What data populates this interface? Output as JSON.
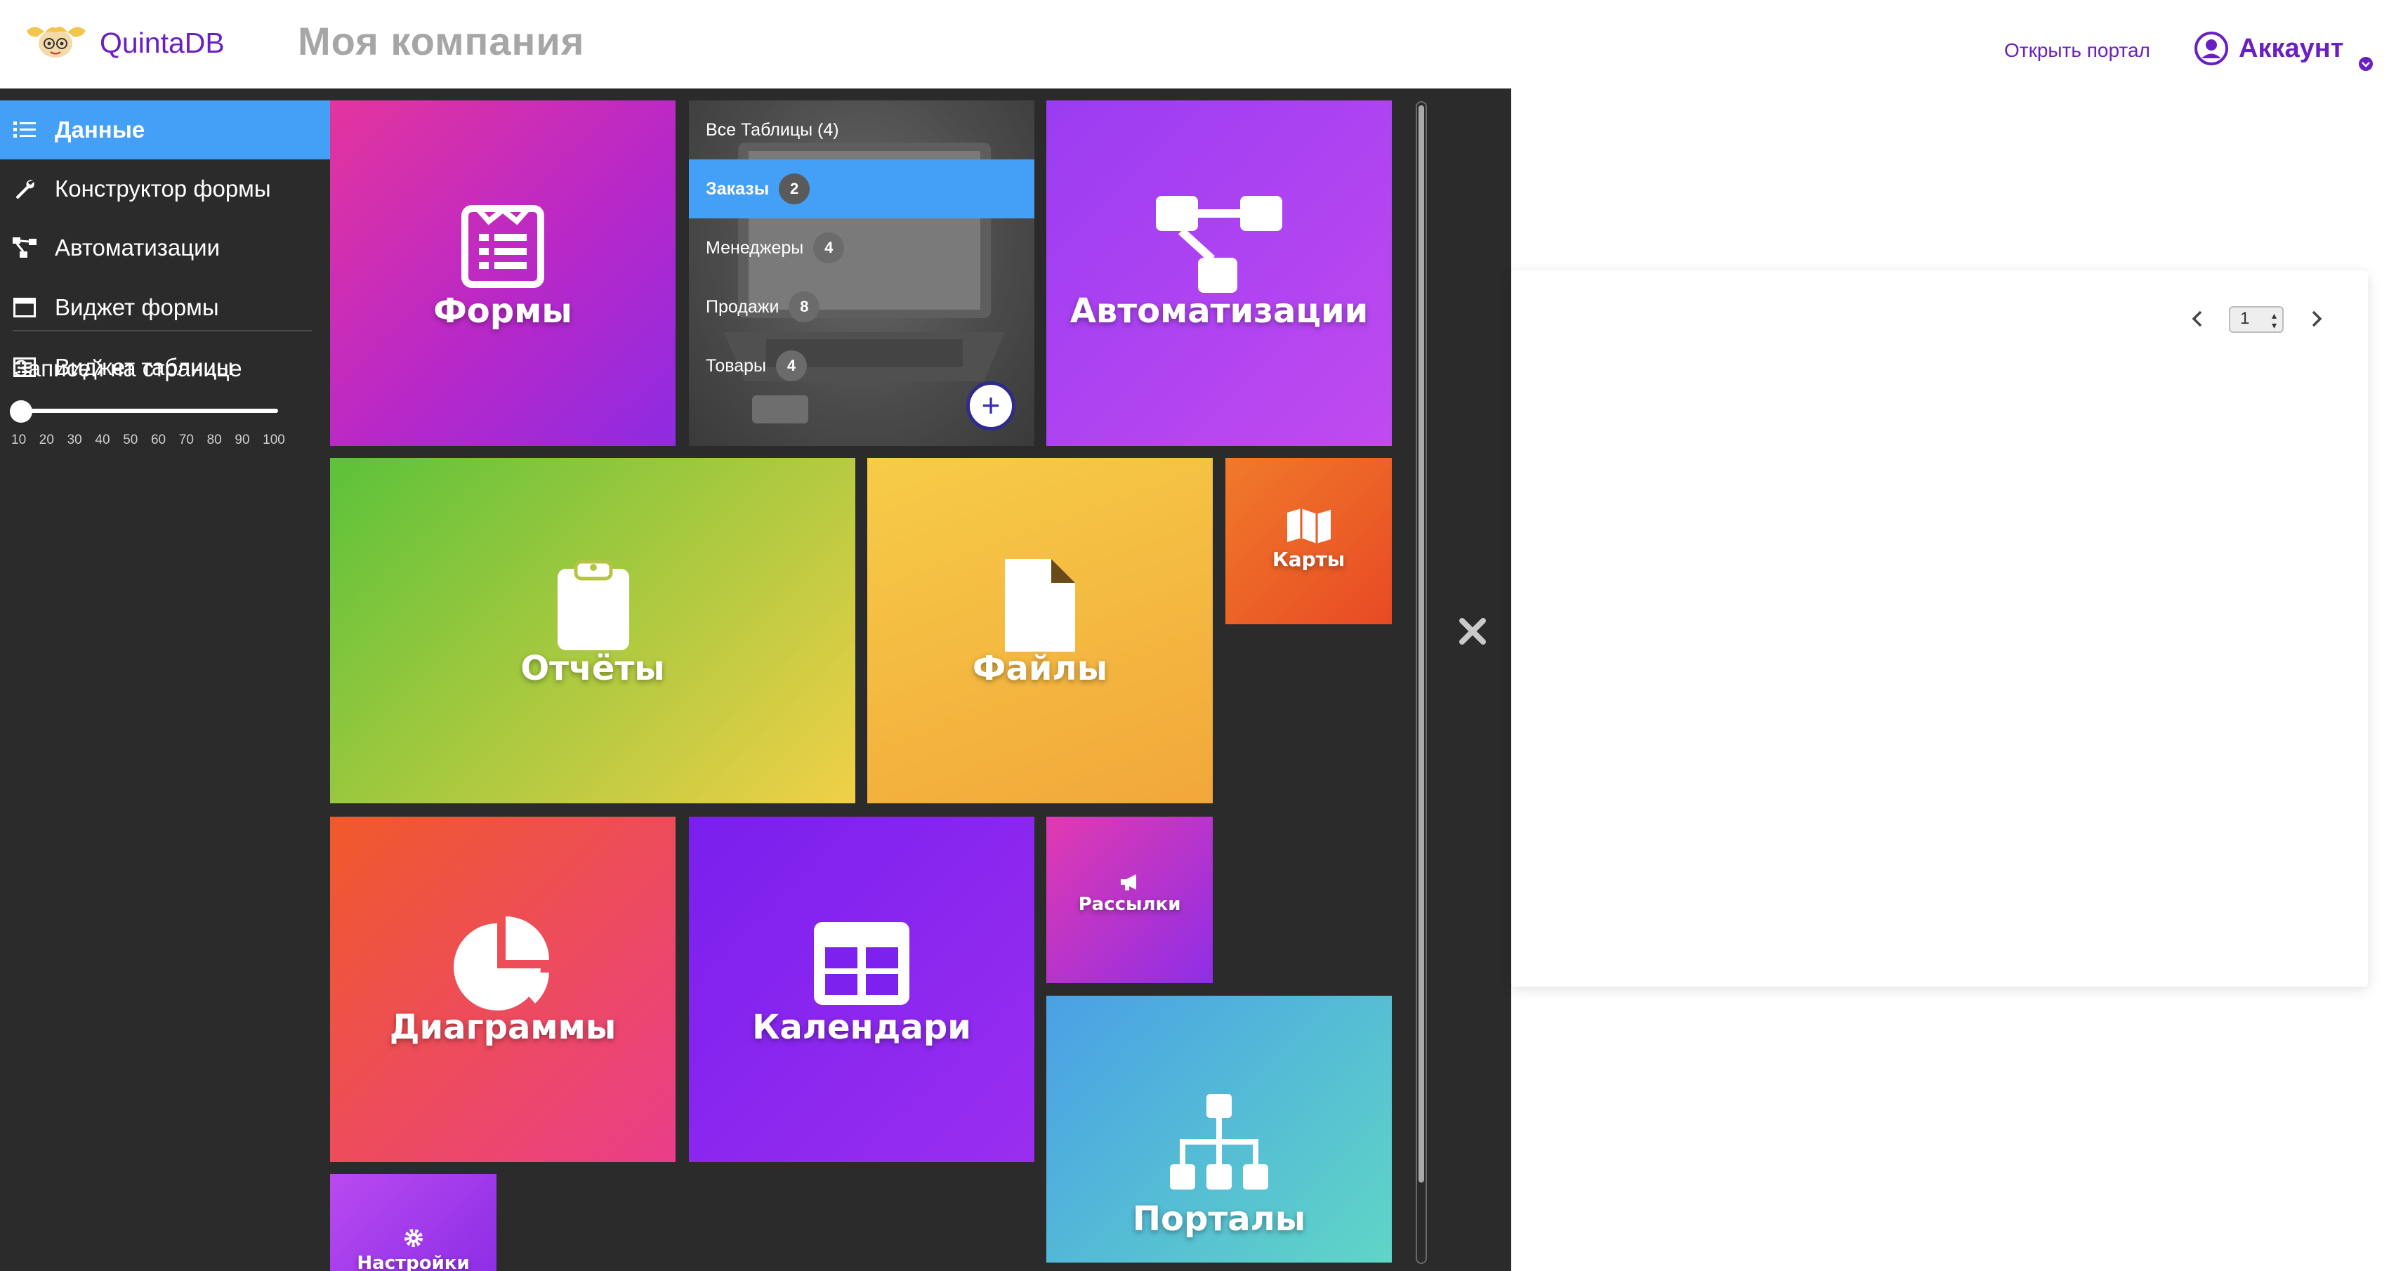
{
  "header": {
    "logo_text": "QuintaDB",
    "company_name": "Моя компания",
    "open_portal": "Открыть портал",
    "account": "Аккаунт"
  },
  "sidebar": {
    "items": [
      {
        "label": "Данные",
        "icon": "list-icon",
        "active": true
      },
      {
        "label": "Конструктор формы",
        "icon": "wrench-icon",
        "active": false
      },
      {
        "label": "Автоматизации",
        "icon": "flow-icon",
        "active": false
      },
      {
        "label": "Виджет формы",
        "icon": "window-icon",
        "active": false
      },
      {
        "label": "Виджет таблицы",
        "icon": "table-list-icon",
        "active": false
      }
    ],
    "per_page_title": "Записей на странице",
    "per_page_ticks": [
      "10",
      "20",
      "30",
      "40",
      "50",
      "60",
      "70",
      "80",
      "90",
      "100"
    ],
    "per_page_value": 10
  },
  "tiles": {
    "forms": "Формы",
    "automations": "Автоматизации",
    "reports": "Отчёты",
    "files": "Файлы",
    "maps": "Карты",
    "charts": "Диаграммы",
    "calendars": "Календари",
    "mailings": "Рассылки",
    "portals": "Порталы",
    "settings": "Настройки"
  },
  "tables": {
    "all": "Все Таблицы (4)",
    "items": [
      {
        "name": "Заказы",
        "count": "2",
        "active": true
      },
      {
        "name": "Менеджеры",
        "count": "4",
        "active": false
      },
      {
        "name": "Продажи",
        "count": "8",
        "active": false
      },
      {
        "name": "Товары",
        "count": "4",
        "active": false
      }
    ],
    "add_label": "+"
  },
  "pager": {
    "page": "1"
  },
  "colors": {
    "accent": "#6a1fc2",
    "active_blue": "#43a0f6",
    "sidebar_bg": "#2b2b2b"
  }
}
